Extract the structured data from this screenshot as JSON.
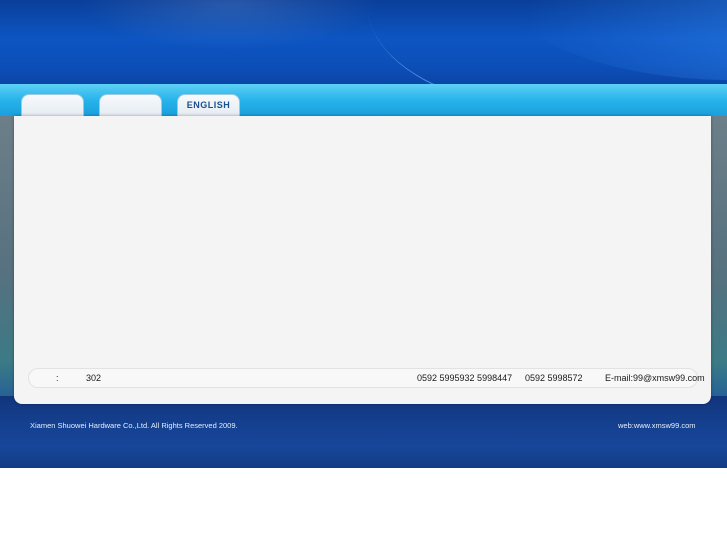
{
  "header": {
    "tabs": [
      {
        "label": ""
      },
      {
        "label": ""
      },
      {
        "label": "ENGLISH"
      }
    ]
  },
  "contact": {
    "address_prefix": ":",
    "address": "302",
    "phones": "0592 5995932 5998447",
    "fax": "0592 5998572",
    "email": "E-mail:99@xmsw99.com"
  },
  "footer": {
    "copyright": "Xiamen Shuowei Hardware Co.,Ltd. All Rights Reserved 2009.",
    "web": "web:www.xmsw99.com"
  },
  "colors": {
    "banner": "#0d55c2",
    "nav_band": "#27b3ea",
    "content_bg": "#f4f4f4",
    "footer_bg": "#143f8e",
    "tab_text": "#1b4f8e"
  }
}
